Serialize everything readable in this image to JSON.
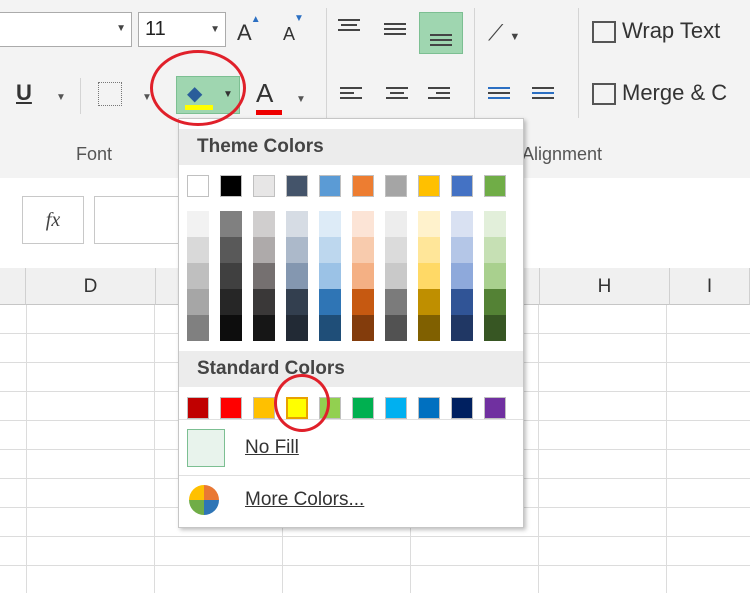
{
  "toolbar": {
    "font_size": "11",
    "grow_font": "A",
    "shrink_font": "A",
    "wrap_text": "Wrap Text",
    "merge_center": "Merge & C",
    "underline": "U",
    "font_color_glyph": "A",
    "group_font": "Font",
    "group_alignment": "Alignment",
    "fill_color_current": "#ffff00",
    "font_color_current": "#e00000"
  },
  "formula_bar": {
    "fx": "fx"
  },
  "columns": [
    "D",
    "H",
    "I"
  ],
  "dropdown": {
    "theme_header": "Theme Colors",
    "standard_header": "Standard Colors",
    "no_fill": "No Fill",
    "more_colors": "More Colors...",
    "theme_colors": [
      {
        "base": "#ffffff",
        "shades": [
          "#f2f2f2",
          "#d9d9d9",
          "#bfbfbf",
          "#a6a6a6",
          "#808080"
        ]
      },
      {
        "base": "#000000",
        "shades": [
          "#808080",
          "#595959",
          "#404040",
          "#262626",
          "#0d0d0d"
        ]
      },
      {
        "base": "#e7e6e6",
        "shades": [
          "#d0cece",
          "#aeaaaa",
          "#757070",
          "#3a3838",
          "#161616"
        ]
      },
      {
        "base": "#44546a",
        "shades": [
          "#d6dce4",
          "#acb9ca",
          "#8497b0",
          "#333f4f",
          "#222a35"
        ]
      },
      {
        "base": "#5b9bd5",
        "shades": [
          "#ddebf7",
          "#bdd7ee",
          "#9bc2e6",
          "#2f75b5",
          "#1f4e78"
        ]
      },
      {
        "base": "#ed7d31",
        "shades": [
          "#fce4d6",
          "#f8cbad",
          "#f4b084",
          "#c65911",
          "#833c0c"
        ]
      },
      {
        "base": "#a5a5a5",
        "shades": [
          "#ededed",
          "#dbdbdb",
          "#c9c9c9",
          "#7b7b7b",
          "#525252"
        ]
      },
      {
        "base": "#ffc000",
        "shades": [
          "#fff2cc",
          "#ffe699",
          "#ffd966",
          "#bf8f00",
          "#806000"
        ]
      },
      {
        "base": "#4472c4",
        "shades": [
          "#d9e1f2",
          "#b4c6e7",
          "#8ea9db",
          "#305496",
          "#203764"
        ]
      },
      {
        "base": "#70ad47",
        "shades": [
          "#e2efda",
          "#c6e0b4",
          "#a9d08e",
          "#548235",
          "#375623"
        ]
      }
    ],
    "standard_colors": [
      "#c00000",
      "#ff0000",
      "#ffc000",
      "#ffff00",
      "#92d050",
      "#00b050",
      "#00b0f0",
      "#0070c0",
      "#002060",
      "#7030a0"
    ],
    "selected_standard_index": 3
  }
}
